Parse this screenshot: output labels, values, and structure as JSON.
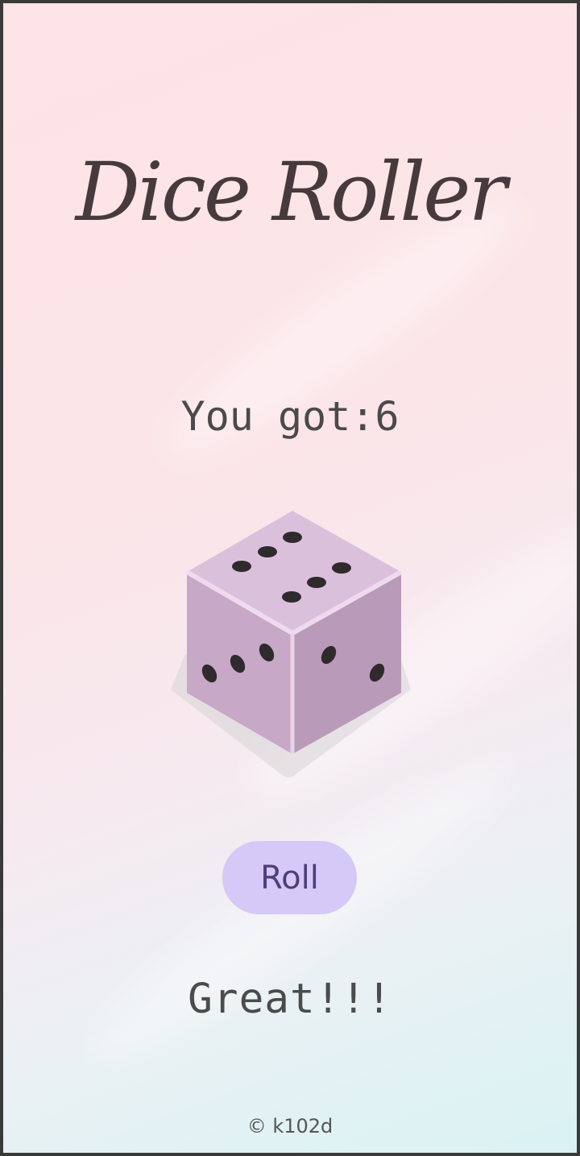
{
  "app": {
    "title": "Dice Roller"
  },
  "result": {
    "text": "You got:6",
    "value": 6
  },
  "dice": {
    "icon": "dice-six-icon",
    "face_color": "#d9bcd9"
  },
  "actions": {
    "roll_label": "Roll"
  },
  "message": {
    "text": "Great!!!"
  },
  "footer": {
    "copyright": "© k102d"
  },
  "colors": {
    "button_bg": "#d5c9f7",
    "button_text": "#4e3f7a",
    "title_text": "#463a3d"
  }
}
